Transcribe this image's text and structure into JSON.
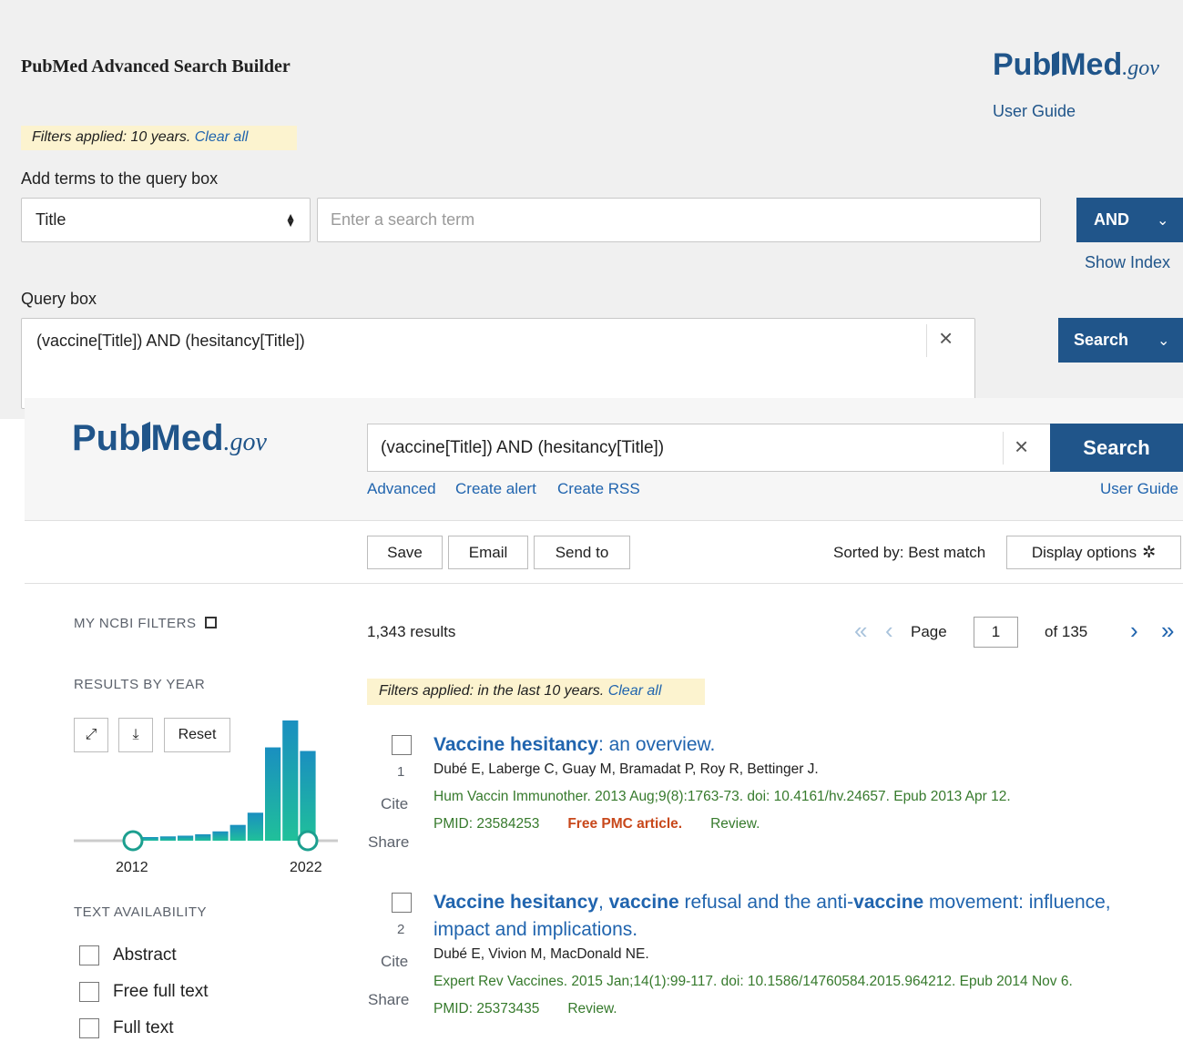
{
  "advanced": {
    "title": "PubMed Advanced Search Builder",
    "logo": {
      "pub": "Pub",
      "med": "Med",
      "gov": ".gov"
    },
    "user_guide": "User Guide",
    "filters_text": "Filters applied: 10 years. ",
    "filters_clear": "Clear all",
    "add_terms_label": "Add terms to the query box",
    "field_select": "Title",
    "term_placeholder": "Enter a search term",
    "and_button": "AND",
    "show_index": "Show Index",
    "query_label": "Query box",
    "query_value": "(vaccine[Title]) AND (hesitancy[Title])",
    "search_button": "Search"
  },
  "header": {
    "logo": {
      "pub": "Pub",
      "med": "Med",
      "gov": ".gov"
    },
    "search_value": "(vaccine[Title]) AND (hesitancy[Title])",
    "search_button": "Search",
    "links": {
      "advanced": "Advanced",
      "create_alert": "Create alert",
      "create_rss": "Create RSS",
      "user_guide": "User Guide"
    }
  },
  "toolbar": {
    "save": "Save",
    "email": "Email",
    "send_to": "Send to",
    "sorted_by": "Sorted by: Best match",
    "display_options": "Display options"
  },
  "sidebar": {
    "my_filters": "MY NCBI FILTERS",
    "results_by_year": "RESULTS BY YEAR",
    "reset": "Reset",
    "year_start": "2012",
    "year_end": "2022",
    "text_availability": "TEXT AVAILABILITY",
    "checkboxes": [
      "Abstract",
      "Free full text",
      "Full text"
    ]
  },
  "chart_data": {
    "type": "bar",
    "title": "",
    "x": [
      2012,
      2013,
      2014,
      2015,
      2016,
      2017,
      2018,
      2019,
      2020,
      2021,
      2022
    ],
    "values": [
      5,
      8,
      12,
      14,
      18,
      26,
      44,
      78,
      260,
      335,
      250
    ],
    "range_start": 2012,
    "range_end": 2022
  },
  "results": {
    "count": "1,343 results",
    "pager": {
      "page_label": "Page",
      "page_value": "1",
      "of": "of 135"
    },
    "filters_text": "Filters applied: in the last 10 years. ",
    "filters_clear": "Clear all",
    "cite": "Cite",
    "share": "Share",
    "articles": [
      {
        "num": "1",
        "title_parts": [
          {
            "text": "Vaccine hesitancy",
            "bold": true
          },
          {
            "text": ": an overview.",
            "bold": false
          }
        ],
        "authors": "Dubé E, Laberge C, Guay M, Bramadat P, Roy R, Bettinger J.",
        "journal": "Hum Vaccin Immunother. 2013 Aug;9(8):1763-73. doi: 10.4161/hv.24657. Epub 2013 Apr 12.",
        "pmid": "PMID: 23584253",
        "free": "Free PMC article.",
        "type": "Review."
      },
      {
        "num": "2",
        "title_parts": [
          {
            "text": "Vaccine hesitancy",
            "bold": true
          },
          {
            "text": ", ",
            "bold": false
          },
          {
            "text": "vaccine",
            "bold": true
          },
          {
            "text": " refusal and the anti-",
            "bold": false
          },
          {
            "text": "vaccine",
            "bold": true
          },
          {
            "text": " movement: influence, impact and implications.",
            "bold": false
          }
        ],
        "authors": "Dubé E, Vivion M, MacDonald NE.",
        "journal": "Expert Rev Vaccines. 2015 Jan;14(1):99-117. doi: 10.1586/14760584.2015.964212. Epub 2014 Nov 6.",
        "pmid": "PMID: 25373435",
        "free": "",
        "type": "Review."
      }
    ]
  },
  "colors": {
    "brand": "#20558a",
    "link": "#2064ae",
    "journal": "#367a2c",
    "free": "#c8481b",
    "filter_bg": "#fcf3cf",
    "bar_top": "#1a8fc0",
    "bar_bottom": "#20c09a"
  }
}
